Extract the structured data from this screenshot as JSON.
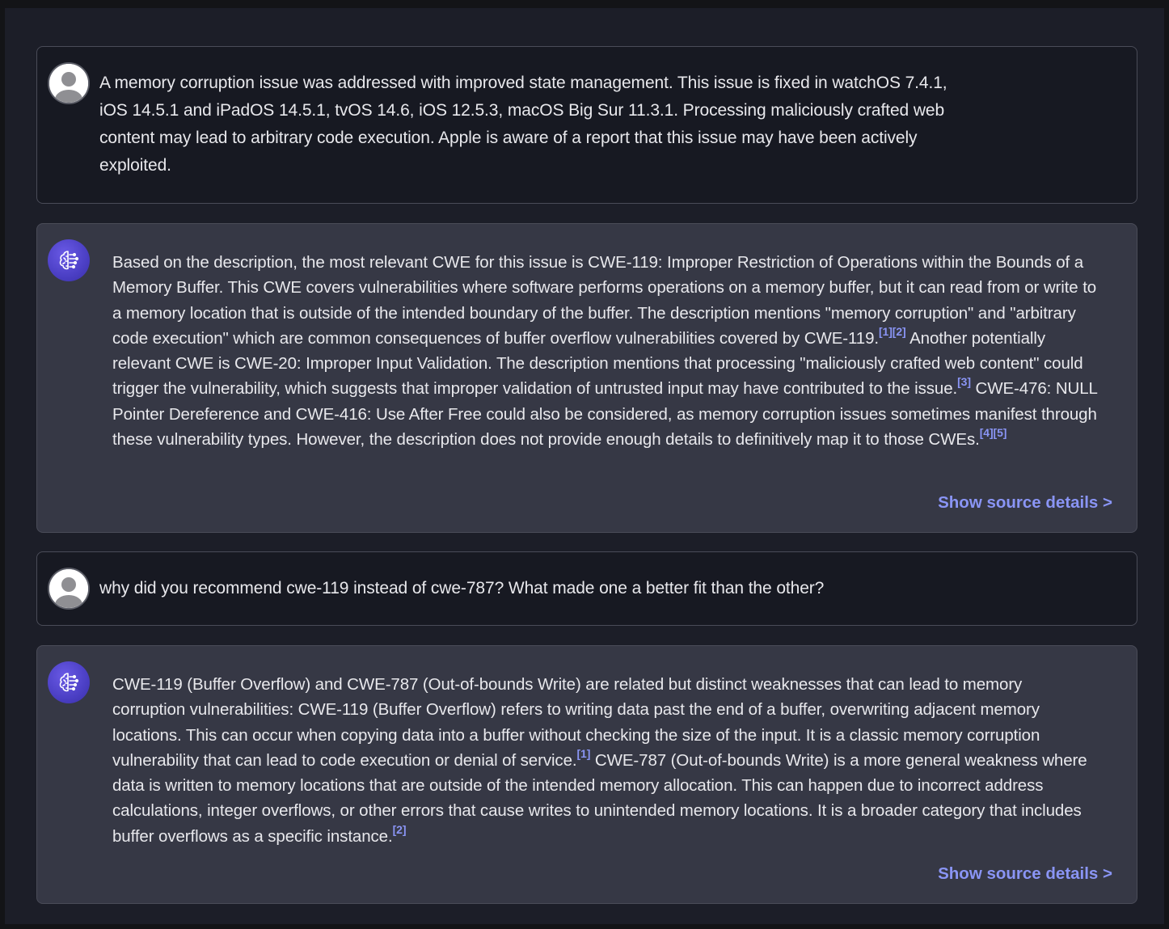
{
  "conversation": {
    "messages": [
      {
        "role": "user",
        "avatar_icon": "user-avatar-icon",
        "text": "A memory corruption issue was addressed with improved state management. This issue is fixed in watchOS 7.4.1, iOS 14.5.1 and iPadOS 14.5.1, tvOS 14.6, iOS 12.5.3, macOS Big Sur 11.3.1. Processing maliciously crafted web content may lead to arbitrary code execution. Apple is aware of a report that this issue may have been actively exploited."
      },
      {
        "role": "assistant",
        "avatar_icon": "ai-brain-icon",
        "segments": [
          {
            "text": "Based on the description, the most relevant CWE for this issue is CWE-119: Improper Restriction of Operations within the Bounds of a Memory Buffer. This CWE covers vulnerabilities where software performs operations on a memory buffer, but it can read from or write to a memory location that is outside of the intended boundary of the buffer. The description mentions \"memory corruption\" and \"arbitrary code execution\" which are common consequences of buffer overflow vulnerabilities covered by CWE-119."
          },
          {
            "cite": "[1][2]"
          },
          {
            "text": " Another potentially relevant CWE is CWE-20: Improper Input Validation. The description mentions that processing \"maliciously crafted web content\" could trigger the vulnerability, which suggests that improper validation of untrusted input may have contributed to the issue."
          },
          {
            "cite": "[3]"
          },
          {
            "text": " CWE-476: NULL Pointer Dereference and CWE-416: Use After Free could also be considered, as memory corruption issues sometimes manifest through these vulnerability types. However, the description does not provide enough details to definitively map it to those CWEs."
          },
          {
            "cite": "[4][5]"
          }
        ],
        "source_link": "Show source details >"
      },
      {
        "role": "user",
        "avatar_icon": "user-avatar-icon",
        "text": "why did you recommend cwe-119 instead of cwe-787? What made one a better fit than the other?"
      },
      {
        "role": "assistant",
        "avatar_icon": "ai-brain-icon",
        "segments": [
          {
            "text": "CWE-119 (Buffer Overflow) and CWE-787 (Out-of-bounds Write) are related but distinct weaknesses that can lead to memory corruption vulnerabilities: CWE-119 (Buffer Overflow) refers to writing data past the end of a buffer, overwriting adjacent memory locations. This can occur when copying data into a buffer without checking the size of the input. It is a classic memory corruption vulnerability that can lead to code execution or denial of service."
          },
          {
            "cite": "[1]"
          },
          {
            "text": " CWE-787 (Out-of-bounds Write) is a more general weakness where data is written to memory locations that are outside of the intended memory allocation. This can happen due to incorrect address calculations, integer overflows, or other errors that cause writes to unintended memory locations. It is a broader category that includes buffer overflows as a specific instance."
          },
          {
            "cite": "[2]"
          }
        ],
        "source_link": "Show source details >"
      }
    ]
  },
  "colors": {
    "background": "#1c1e28",
    "user_bubble": "#171922",
    "assistant_bubble": "#363845",
    "accent_link": "#8a95f5",
    "bot_avatar": "#4b3fc4"
  }
}
